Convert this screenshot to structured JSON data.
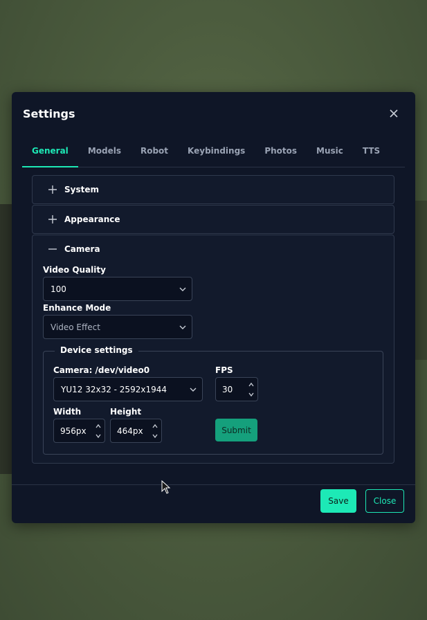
{
  "dialog": {
    "title": "Settings",
    "tabs": [
      "General",
      "Models",
      "Robot",
      "Keybindings",
      "Photos",
      "Music",
      "TTS"
    ],
    "active_tab": "General"
  },
  "sections": {
    "system": "System",
    "appearance": "Appearance",
    "camera": "Camera"
  },
  "camera": {
    "video_quality_label": "Video Quality",
    "video_quality_value": "100",
    "enhance_mode_label": "Enhance Mode",
    "enhance_mode_value": "Video Effect",
    "device_settings_legend": "Device settings",
    "device_label": "Camera: /dev/video0",
    "device_format": "YU12 32x32 - 2592x1944",
    "fps_label": "FPS",
    "fps_value": "30",
    "width_label": "Width",
    "width_value": "956px",
    "height_label": "Height",
    "height_value": "464px",
    "submit_label": "Submit"
  },
  "footer": {
    "save_label": "Save",
    "close_label": "Close"
  },
  "colors": {
    "accent": "#1de9b6",
    "submit": "#15a07c",
    "modal_bg": "#0f1627"
  },
  "icons": [
    "close-icon",
    "plus-icon",
    "minus-icon",
    "chevron-down-icon",
    "spinner-arrows-icon",
    "mouse-cursor-icon"
  ]
}
